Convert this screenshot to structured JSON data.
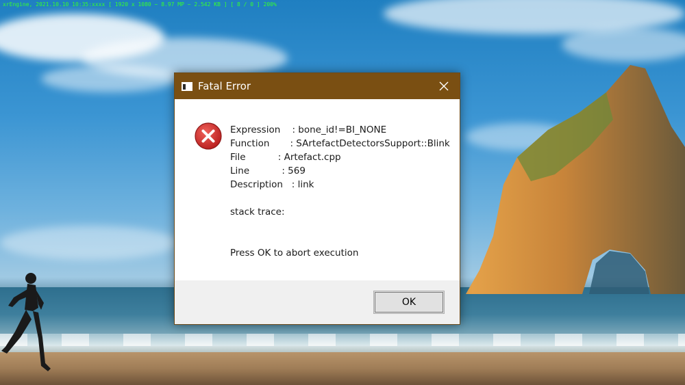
{
  "overlay": {
    "text": "xrEngine, 2021.10.10 10:35:xxxx [ 1920 x 1080 ~ 8.97 MP ~ 2.542 KB ] [ 8 / 0 ] 200%"
  },
  "dialog": {
    "title": "Fatal Error",
    "icons": {
      "app": "window-icon",
      "close": "close-icon",
      "error": "error-icon"
    },
    "message": {
      "expression": "Expression    : bone_id!=BI_NONE",
      "function": "Function       : SArtefactDetectorsSupport::Blink",
      "file": "File           : Artefact.cpp",
      "line": "Line           : 569",
      "description": "Description   : link",
      "stack_trace": "stack trace:",
      "prompt": "Press OK to abort execution"
    },
    "ok_label": "OK"
  },
  "colors": {
    "titlebar": "#7a4f12",
    "error_red": "#c62828",
    "overlay_green": "#36ff2e"
  }
}
